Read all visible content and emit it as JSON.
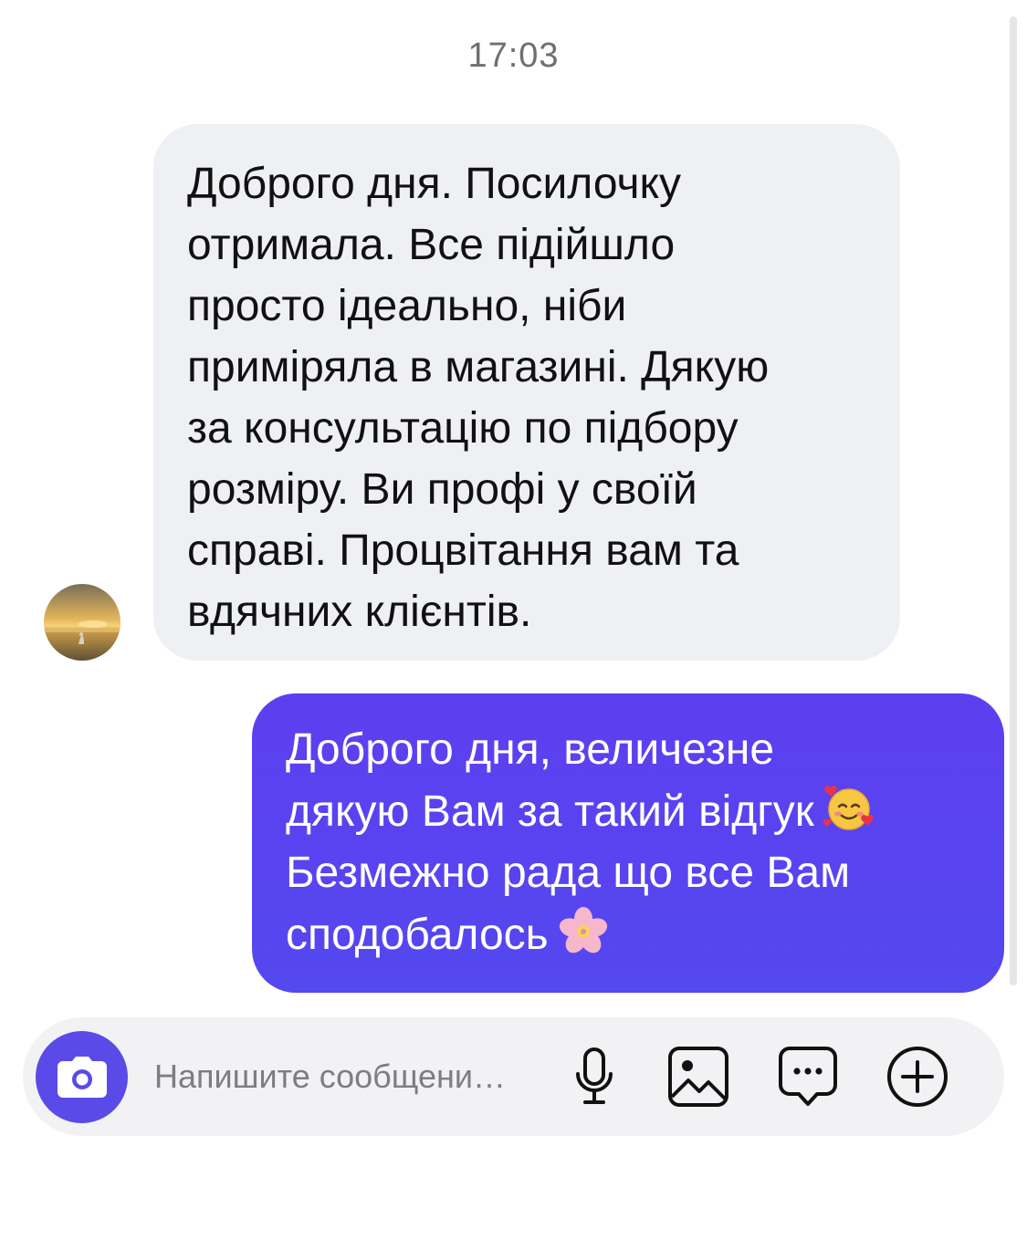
{
  "header": {
    "timestamp": "17:03"
  },
  "messages": [
    {
      "direction": "incoming",
      "text": "Доброго дня. Посилочку\nотримала. Все підійшло\nпросто ідеально, ніби\nприміряла в магазині. Дякую\nза  консультацію по підбору\nрозміру. Ви профі  у своїй\nсправі. Процвітання вам та\nвдячних клієнтів."
    },
    {
      "direction": "outgoing",
      "line1": "Доброго дня, величезне",
      "line2": "дякую Вам за такий відгук",
      "line2_emoji": "smiling-face-with-hearts",
      "line3": "Безмежно рада що все Вам",
      "line4": "сподобалось",
      "line4_emoji": "cherry-blossom"
    }
  ],
  "composer": {
    "placeholder": "Напишите сообщени…",
    "value": "",
    "buttons": [
      "camera-icon",
      "microphone-icon",
      "gallery-icon",
      "sticker-icon",
      "plus-circle-icon"
    ]
  },
  "colors": {
    "accent": "#5a4be8",
    "outgoing_bubble": "#5448ef",
    "incoming_bubble": "#eff0f4",
    "composer_bg": "#f2f2f4"
  }
}
